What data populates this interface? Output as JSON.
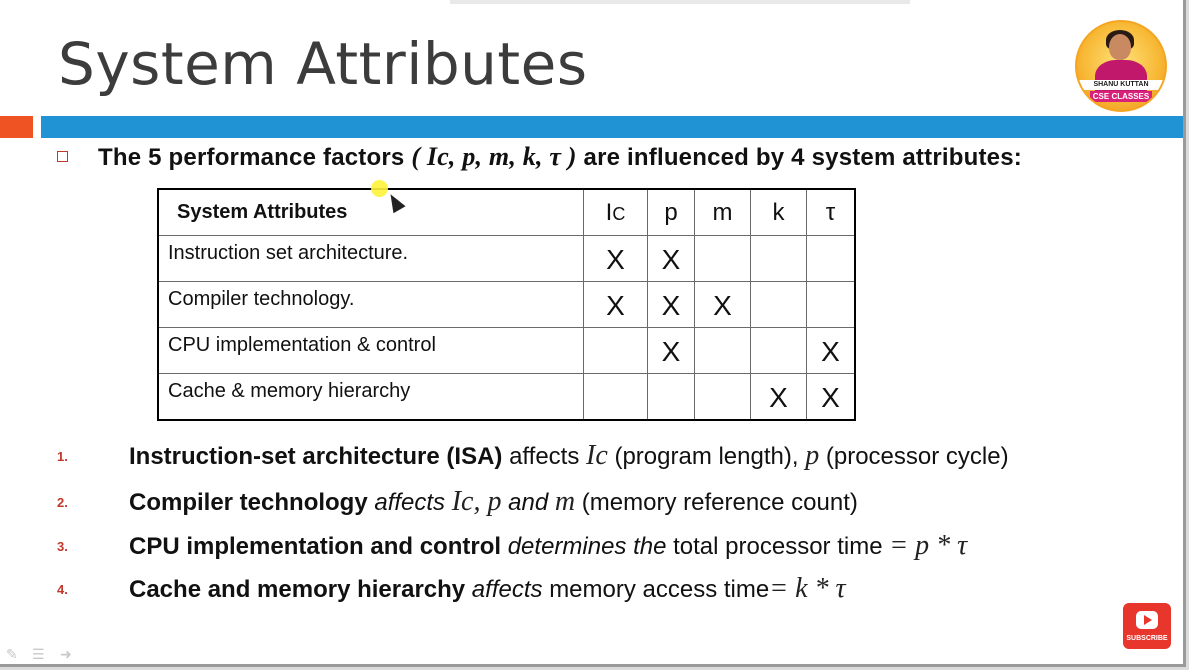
{
  "slide": {
    "title": "System Attributes",
    "logo": {
      "line1": "SHANU KUTTAN",
      "line2": "CSE CLASSES"
    },
    "intro": {
      "text_before": "The 5 performance factors ",
      "factors": "( Ic, p, m, k, τ )",
      "text_after": " are influenced by 4 system attributes:"
    },
    "table": {
      "headers": [
        "System Attributes",
        "I",
        "C",
        "p",
        "m",
        "k",
        "τ"
      ],
      "rows": [
        {
          "label": "Instruction set architecture.",
          "marks": [
            "X",
            "X",
            "",
            "",
            ""
          ]
        },
        {
          "label": "Compiler technology.",
          "marks": [
            "X",
            "X",
            "X",
            "",
            ""
          ]
        },
        {
          "label": "CPU implementation & control",
          "marks": [
            "",
            "X",
            "",
            "",
            "X"
          ]
        },
        {
          "label": "Cache & memory hierarchy",
          "marks": [
            "",
            "",
            "",
            "X",
            "X"
          ]
        }
      ]
    },
    "items": [
      {
        "num": "1.",
        "bold": "Instruction-set architecture (ISA)",
        "verb": " affects ",
        "var1": "Ic",
        "rest1": " (program length), ",
        "var2": "p",
        "rest2": " (processor cycle)"
      },
      {
        "num": "2.",
        "bold": "Compiler technology",
        "verb": " affects ",
        "var1": "Ic, p",
        "rest1": " and ",
        "var2": "m",
        "rest2": " (memory reference count)"
      },
      {
        "num": "3.",
        "bold": "CPU implementation and control",
        "verb": " determines the ",
        "rest1": "total processor time ",
        "var1": "= p * τ"
      },
      {
        "num": "4.",
        "bold": "Cache and memory hierarchy",
        "verb": " affects ",
        "rest1": "memory access time",
        "var1": "= k * τ"
      }
    ],
    "subscribe_label": "SUBSCRIBE"
  },
  "colors": {
    "accent_red": "#ef5323",
    "accent_blue": "#1f93d3",
    "number_red": "#c0392b",
    "subscribe_red": "#e8362d"
  }
}
